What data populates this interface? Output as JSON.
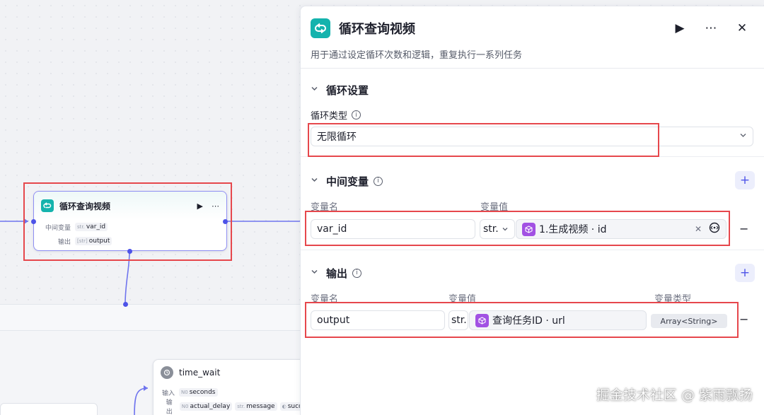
{
  "canvas": {
    "loop_node": {
      "title": "循环查询视频",
      "rows": [
        {
          "label": "中间变量",
          "type": "str.",
          "value": "var_id"
        },
        {
          "label": "输出",
          "type": "[str]",
          "value": "output"
        }
      ]
    },
    "time_node": {
      "title": "time_wait",
      "rows": [
        {
          "label": "输入",
          "chips": [
            {
              "type": "N0",
              "value": "seconds"
            }
          ]
        },
        {
          "label": "输出",
          "chips": [
            {
              "type": "N0",
              "value": "actual_delay"
            },
            {
              "type": "str.",
              "value": "message"
            },
            {
              "type": "◐",
              "value": "succ"
            }
          ]
        }
      ]
    }
  },
  "panel": {
    "title": "循环查询视频",
    "description": "用于通过设定循环次数和逻辑，重复执行一系列任务",
    "loop_settings": {
      "section_title": "循环设置",
      "field_label": "循环类型",
      "selected_value": "无限循环"
    },
    "variables": {
      "section_title": "中间变量",
      "name_header": "变量名",
      "value_header": "变量值",
      "rows": [
        {
          "name": "var_id",
          "type": "str.",
          "ref_text": "1.生成视频 · id"
        }
      ]
    },
    "output": {
      "section_title": "输出",
      "name_header": "变量名",
      "value_header": "变量值",
      "type_header": "变量类型",
      "rows": [
        {
          "name": "output",
          "type": "str.",
          "ref_text": "查询任务ID · url",
          "var_type": "Array<String>"
        }
      ]
    }
  },
  "watermark": "掘金技术社区 @ 紫雨飘扬",
  "colors": {
    "accent": "#4d53e8",
    "loop_icon": "#14b3ad",
    "ref_icon": "#a251e3",
    "highlight": "#e6474c"
  }
}
